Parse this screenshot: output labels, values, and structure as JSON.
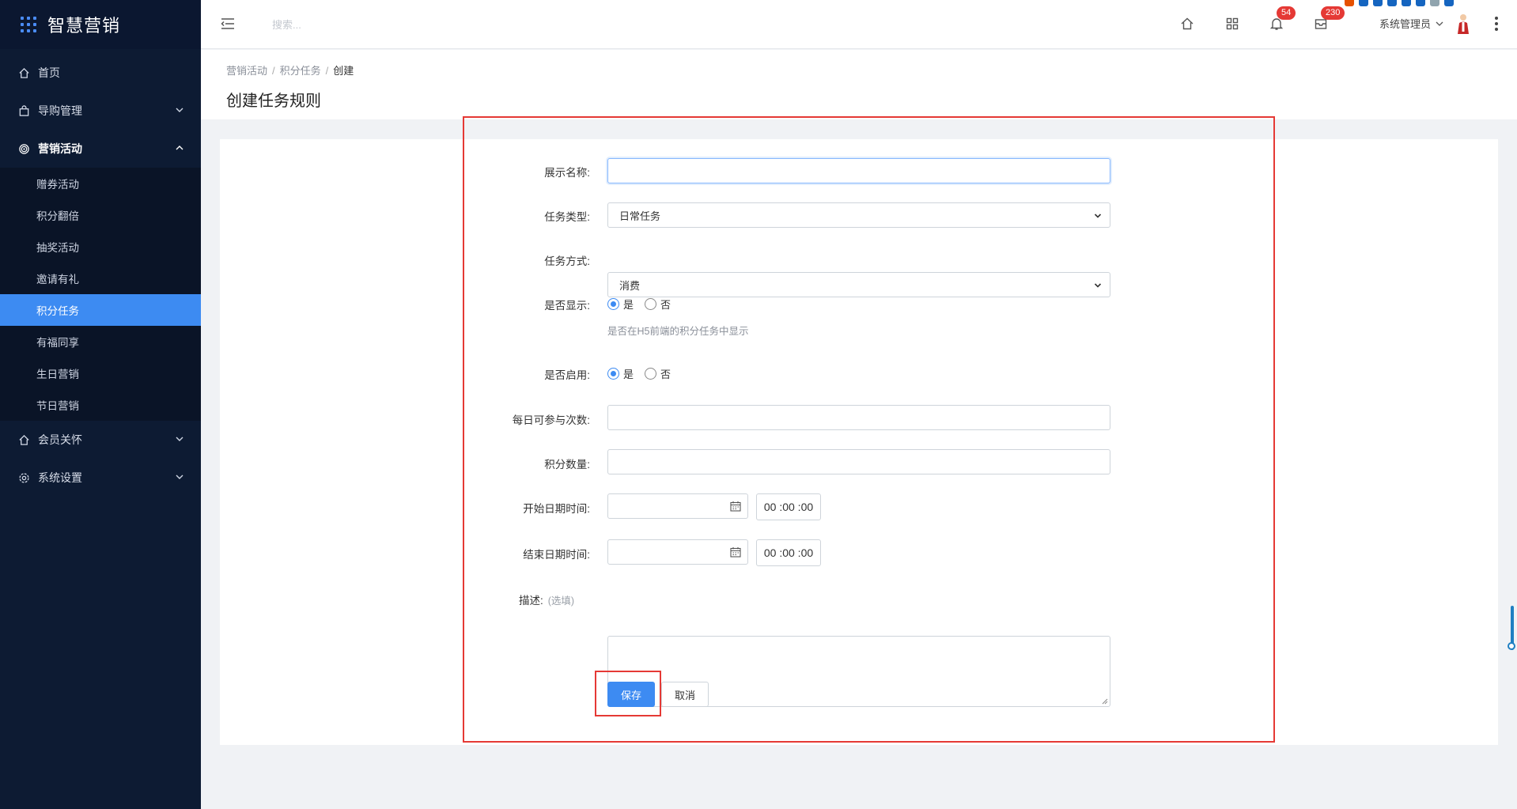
{
  "brand": {
    "title": "智慧营销"
  },
  "sidebar": {
    "items": [
      {
        "label": "首页",
        "icon": "home-icon"
      },
      {
        "label": "导购管理",
        "icon": "bag-icon"
      },
      {
        "label": "营销活动",
        "icon": "target-icon"
      },
      {
        "label": "会员关怀",
        "icon": "home-icon"
      },
      {
        "label": "系统设置",
        "icon": "gear-icon"
      }
    ],
    "submenu": [
      {
        "label": "赠券活动"
      },
      {
        "label": "积分翻倍"
      },
      {
        "label": "抽奖活动"
      },
      {
        "label": "邀请有礼"
      },
      {
        "label": "积分任务"
      },
      {
        "label": "有福同享"
      },
      {
        "label": "生日营销"
      },
      {
        "label": "节日营销"
      }
    ]
  },
  "topbar": {
    "search_placeholder": "搜索...",
    "notifications_count": "54",
    "messages_count": "230",
    "user_name": "系统管理员"
  },
  "breadcrumb": {
    "level1": "营销活动",
    "level2": "积分任务",
    "current": "创建"
  },
  "page": {
    "title": "创建任务规则"
  },
  "form": {
    "display_name": {
      "label": "展示名称:",
      "value": ""
    },
    "task_type": {
      "label": "任务类型:",
      "value": "日常任务"
    },
    "task_mode": {
      "label": "任务方式:",
      "value": "消费"
    },
    "show": {
      "label": "是否显示:",
      "yes": "是",
      "no": "否",
      "selected": "yes",
      "help": "是否在H5前端的积分任务中显示"
    },
    "enabled": {
      "label": "是否启用:",
      "yes": "是",
      "no": "否",
      "selected": "yes"
    },
    "daily_times": {
      "label": "每日可参与次数:",
      "value": ""
    },
    "points": {
      "label": "积分数量:",
      "value": ""
    },
    "start_datetime": {
      "label": "开始日期时间:",
      "date": "",
      "time": "00 :00 :00"
    },
    "end_datetime": {
      "label": "结束日期时间:",
      "date": "",
      "time": "00 :00 :00"
    },
    "description": {
      "label": "描述:",
      "optional": "(选填)",
      "value": ""
    },
    "save_label": "保存",
    "cancel_label": "取消"
  },
  "colors": {
    "primary": "#3d8bf2",
    "sidebar_bg": "#0d1b33",
    "highlight": "#e53935",
    "badge": "#e53935"
  }
}
